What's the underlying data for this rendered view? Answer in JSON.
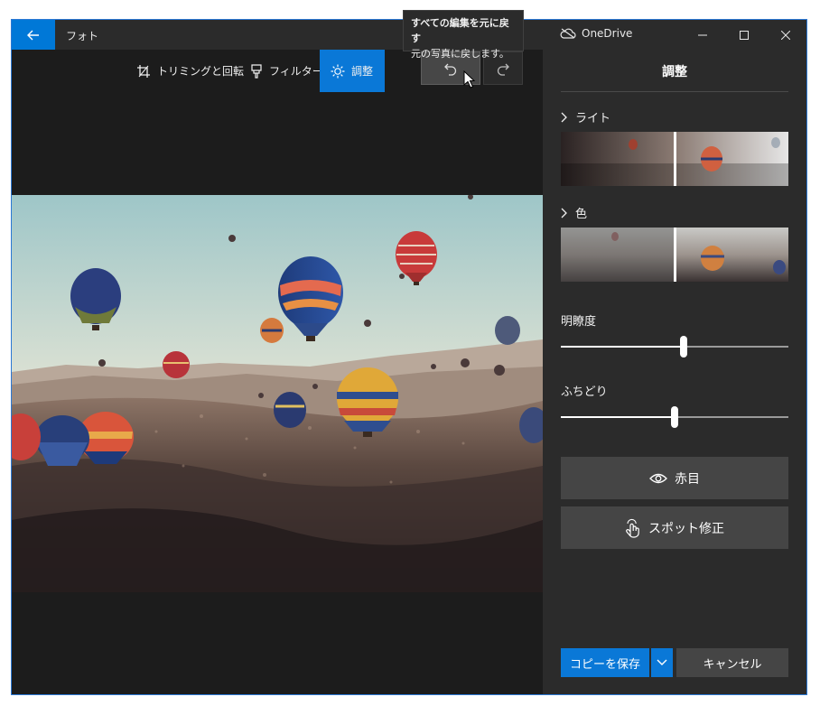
{
  "titlebar": {
    "app_title": "フォト",
    "onedrive": "OneDrive"
  },
  "toolbar": {
    "crop_label": "トリミングと回転",
    "filter_label": "フィルター",
    "adjust_label": "調整"
  },
  "tooltip": {
    "title": "すべての編集を元に戻す",
    "body": "元の写真に戻します。"
  },
  "panel": {
    "title": "調整",
    "light_label": "ライト",
    "color_label": "色",
    "clarity": {
      "label": "明瞭度",
      "value": 0.54
    },
    "vignette": {
      "label": "ふちどり",
      "value": 0.5
    },
    "redeye_label": "赤目",
    "spotfix_label": "スポット修正"
  },
  "footer": {
    "save_label": "コピーを保存",
    "cancel_label": "キャンセル"
  },
  "colors": {
    "accent": "#0a78d7",
    "panel_bg": "#2b2b2b",
    "canvas_bg": "#1c1c1c"
  },
  "icons": [
    "back-arrow-icon",
    "onedrive-cloud-icon",
    "minimize-icon",
    "maximize-icon",
    "close-icon",
    "crop-icon",
    "filter-icon",
    "sun-icon",
    "undo-icon",
    "redo-icon",
    "chevron-right-icon",
    "eye-icon",
    "touch-hand-icon",
    "chevron-down-icon",
    "cursor-icon"
  ]
}
